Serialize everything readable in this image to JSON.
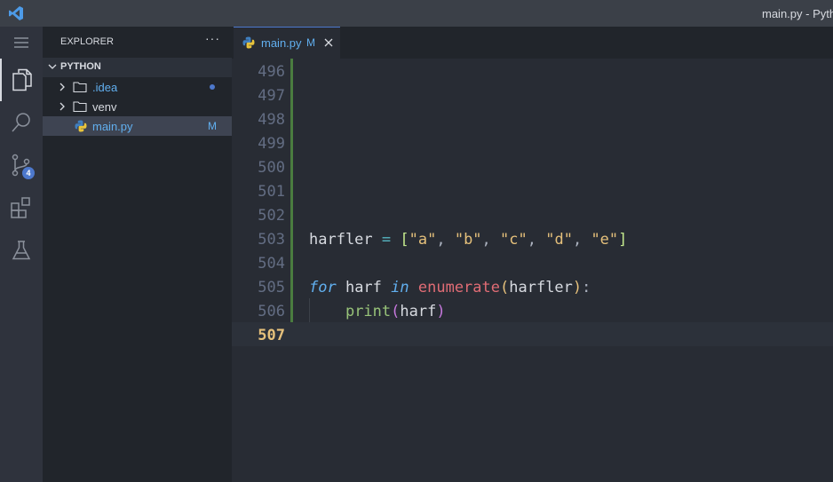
{
  "window": {
    "title": "main.py - Pytho"
  },
  "activity": {
    "scm_badge": "4"
  },
  "sidebar": {
    "header": "EXPLORER",
    "more": "···",
    "section": "PYTHON",
    "items": [
      {
        "name": ".idea",
        "status": ""
      },
      {
        "name": "venv",
        "status": ""
      },
      {
        "name": "main.py",
        "status": "M"
      }
    ]
  },
  "tab": {
    "label": "main.py",
    "status": "M"
  },
  "editor": {
    "line_numbers": [
      "496",
      "497",
      "498",
      "499",
      "500",
      "501",
      "502",
      "503",
      "504",
      "505",
      "506",
      "507"
    ],
    "code": {
      "l503": {
        "var": "harfler",
        "eq": " = ",
        "open": "[",
        "s1": "\"a\"",
        "s2": "\"b\"",
        "s3": "\"c\"",
        "s4": "\"d\"",
        "s5": "\"e\"",
        "comma": ", ",
        "close": "]"
      },
      "l505": {
        "kw_for": "for",
        "var": " harf ",
        "kw_in": "in",
        "fn": "enumerate",
        "open": "(",
        "arg": "harfler",
        "close": ")",
        "colon": ":"
      },
      "l506": {
        "fn": "print",
        "open": "(",
        "arg": "harf",
        "close": ")"
      }
    }
  },
  "colors": {
    "accent": "#4d78cc",
    "modified": "#61afef",
    "git_added": "#4a7c3f"
  }
}
